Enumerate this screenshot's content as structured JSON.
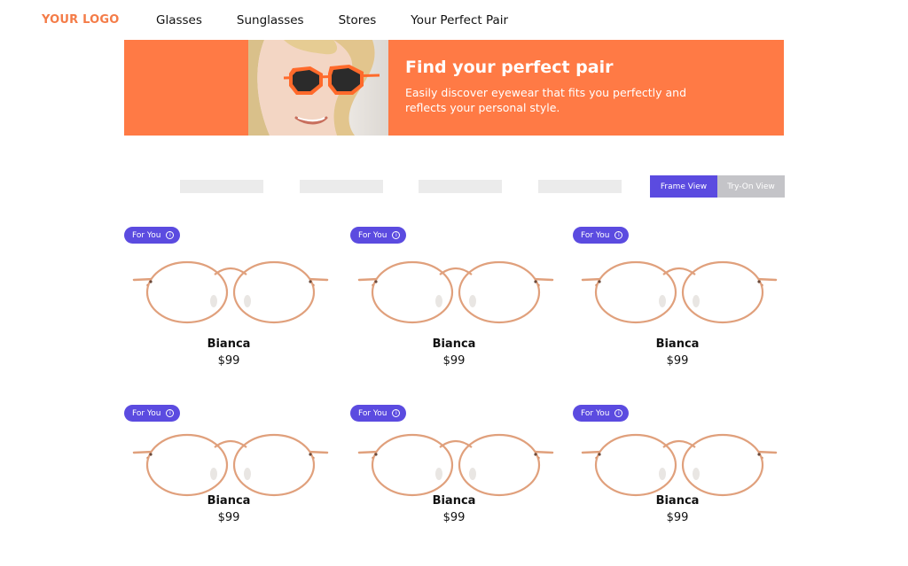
{
  "header": {
    "logo": "YOUR LOGO",
    "nav": [
      "Glasses",
      "Sunglasses",
      "Stores",
      "Your Perfect Pair"
    ]
  },
  "hero": {
    "title": "Find your perfect pair",
    "subtitle": "Easily discover eyewear that fits you perfectly and reflects your personal style."
  },
  "view_toggle": {
    "frame": "Frame View",
    "tryon": "Try-On View",
    "selected": "Frame View"
  },
  "products": [
    {
      "badge": "For You",
      "name": "Bianca",
      "price": "$99"
    },
    {
      "badge": "For You",
      "name": "Bianca",
      "price": "$99"
    },
    {
      "badge": "For You",
      "name": "Bianca",
      "price": "$99"
    },
    {
      "badge": "For You",
      "name": "Bianca",
      "price": "$99"
    },
    {
      "badge": "For You",
      "name": "Bianca",
      "price": "$99"
    },
    {
      "badge": "For You",
      "name": "Bianca",
      "price": "$99"
    }
  ],
  "icons": {
    "badge_info": "info-icon",
    "product_image": "eyeglasses-frame-icon"
  },
  "colors": {
    "brand_orange": "#ff7a45",
    "accent_purple": "#5b4be0",
    "frame_rose_gold": "#e0a07c",
    "temple_tip": "#b55d2c"
  }
}
